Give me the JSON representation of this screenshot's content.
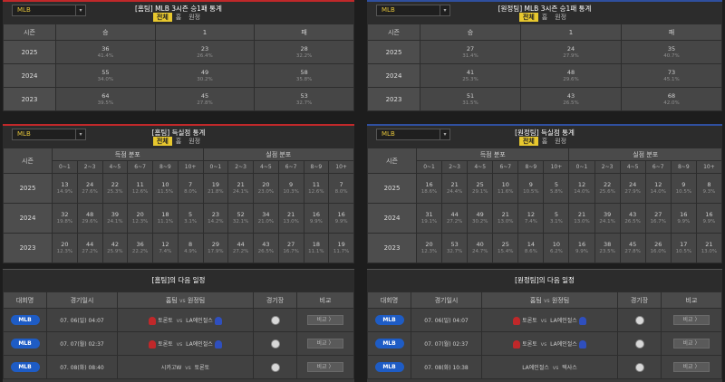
{
  "league_select": "MLB",
  "arrow_glyph": "▾",
  "tabs": {
    "all": "전체",
    "home": "홈",
    "away": "원정"
  },
  "record": {
    "home_title": "[홈팀] MLB 3시즌 승1패 통계",
    "away_title": "[원정팀] MLB 3시즌 승1패 통계",
    "headers": [
      "시즌",
      "승",
      "1",
      "패"
    ],
    "home_rows": [
      {
        "season": "2025",
        "cells": [
          [
            "36",
            "41.4%"
          ],
          [
            "23",
            "26.4%"
          ],
          [
            "28",
            "32.2%"
          ]
        ]
      },
      {
        "season": "2024",
        "cells": [
          [
            "55",
            "34.0%"
          ],
          [
            "49",
            "30.2%"
          ],
          [
            "58",
            "35.8%"
          ]
        ]
      },
      {
        "season": "2023",
        "cells": [
          [
            "64",
            "39.5%"
          ],
          [
            "45",
            "27.8%"
          ],
          [
            "53",
            "32.7%"
          ]
        ]
      }
    ],
    "away_rows": [
      {
        "season": "2025",
        "cells": [
          [
            "27",
            "31.4%"
          ],
          [
            "24",
            "27.9%"
          ],
          [
            "35",
            "40.7%"
          ]
        ]
      },
      {
        "season": "2024",
        "cells": [
          [
            "41",
            "25.3%"
          ],
          [
            "48",
            "29.6%"
          ],
          [
            "73",
            "45.1%"
          ]
        ]
      },
      {
        "season": "2023",
        "cells": [
          [
            "51",
            "31.5%"
          ],
          [
            "43",
            "26.5%"
          ],
          [
            "68",
            "42.0%"
          ]
        ]
      }
    ]
  },
  "runs": {
    "home_title": "[홈팀] 득실점 통계",
    "away_title": "[원정팀] 득실점 통계",
    "season_label": "시즌",
    "scored_label": "득점 분포",
    "allowed_label": "실점 분포",
    "bins": [
      "0~1",
      "2~3",
      "4~5",
      "6~7",
      "8~9",
      "10+"
    ],
    "home_rows": [
      {
        "season": "2025",
        "scored": [
          [
            "13",
            "14.9%"
          ],
          [
            "24",
            "27.6%"
          ],
          [
            "22",
            "25.3%"
          ],
          [
            "11",
            "12.6%"
          ],
          [
            "10",
            "11.5%"
          ],
          [
            "7",
            "8.0%"
          ]
        ],
        "allowed": [
          [
            "19",
            "21.8%"
          ],
          [
            "21",
            "24.1%"
          ],
          [
            "20",
            "23.0%"
          ],
          [
            "9",
            "10.3%"
          ],
          [
            "11",
            "12.6%"
          ],
          [
            "7",
            "8.0%"
          ]
        ]
      },
      {
        "season": "2024",
        "scored": [
          [
            "32",
            "19.8%"
          ],
          [
            "48",
            "29.6%"
          ],
          [
            "39",
            "24.1%"
          ],
          [
            "20",
            "12.3%"
          ],
          [
            "18",
            "11.1%"
          ],
          [
            "5",
            "3.1%"
          ]
        ],
        "allowed": [
          [
            "23",
            "14.2%"
          ],
          [
            "52",
            "32.1%"
          ],
          [
            "34",
            "21.0%"
          ],
          [
            "21",
            "13.0%"
          ],
          [
            "16",
            "9.9%"
          ],
          [
            "16",
            "9.9%"
          ]
        ]
      },
      {
        "season": "2023",
        "scored": [
          [
            "20",
            "12.3%"
          ],
          [
            "44",
            "27.2%"
          ],
          [
            "42",
            "25.9%"
          ],
          [
            "36",
            "22.2%"
          ],
          [
            "12",
            "7.4%"
          ],
          [
            "8",
            "4.9%"
          ]
        ],
        "allowed": [
          [
            "29",
            "17.9%"
          ],
          [
            "44",
            "27.2%"
          ],
          [
            "43",
            "26.5%"
          ],
          [
            "27",
            "16.7%"
          ],
          [
            "18",
            "11.1%"
          ],
          [
            "19",
            "11.7%"
          ]
        ]
      }
    ],
    "away_rows": [
      {
        "season": "2025",
        "scored": [
          [
            "16",
            "18.6%"
          ],
          [
            "21",
            "24.4%"
          ],
          [
            "25",
            "29.1%"
          ],
          [
            "10",
            "11.6%"
          ],
          [
            "9",
            "10.5%"
          ],
          [
            "5",
            "5.8%"
          ]
        ],
        "allowed": [
          [
            "12",
            "14.0%"
          ],
          [
            "22",
            "25.6%"
          ],
          [
            "24",
            "27.9%"
          ],
          [
            "12",
            "14.0%"
          ],
          [
            "9",
            "10.5%"
          ],
          [
            "8",
            "9.3%"
          ]
        ]
      },
      {
        "season": "2024",
        "scored": [
          [
            "31",
            "19.1%"
          ],
          [
            "44",
            "27.2%"
          ],
          [
            "49",
            "30.2%"
          ],
          [
            "21",
            "13.0%"
          ],
          [
            "12",
            "7.4%"
          ],
          [
            "5",
            "3.1%"
          ]
        ],
        "allowed": [
          [
            "21",
            "13.0%"
          ],
          [
            "39",
            "24.1%"
          ],
          [
            "43",
            "26.5%"
          ],
          [
            "27",
            "16.7%"
          ],
          [
            "16",
            "9.9%"
          ],
          [
            "16",
            "9.9%"
          ]
        ]
      },
      {
        "season": "2023",
        "scored": [
          [
            "20",
            "12.3%"
          ],
          [
            "53",
            "32.7%"
          ],
          [
            "40",
            "24.7%"
          ],
          [
            "25",
            "15.4%"
          ],
          [
            "14",
            "8.6%"
          ],
          [
            "10",
            "6.2%"
          ]
        ],
        "allowed": [
          [
            "16",
            "9.9%"
          ],
          [
            "38",
            "23.5%"
          ],
          [
            "45",
            "27.8%"
          ],
          [
            "26",
            "16.0%"
          ],
          [
            "17",
            "10.5%"
          ],
          [
            "21",
            "13.0%"
          ]
        ]
      }
    ]
  },
  "schedule": {
    "home_title": "[홈팀]의 다음 일정",
    "away_title": "[원정팀]의 다음 일정",
    "headers": {
      "league": "대회명",
      "date": "경기일시",
      "home": "홈팀",
      "vs": "vs",
      "away": "원정팀",
      "venue": "경기장",
      "compare": "비교"
    },
    "compare_btn": "비교 〉",
    "home_rows": [
      {
        "league": "MLB",
        "date": "07. 06(일) 04:07",
        "home": "토론토",
        "away": "LA에인절스",
        "home_color": "#c0282a",
        "away_color": "#2f4fbe"
      },
      {
        "league": "MLB",
        "date": "07. 07(월) 02:37",
        "home": "토론토",
        "away": "LA에인절스",
        "home_color": "#c0282a",
        "away_color": "#2f4fbe"
      },
      {
        "league": "MLB",
        "date": "07. 08(화) 08:40",
        "home": "시카고W",
        "away": "토론토",
        "home_color": "",
        "away_color": ""
      }
    ],
    "away_rows": [
      {
        "league": "MLB",
        "date": "07. 06(일) 04:07",
        "home": "토론토",
        "away": "LA에인절스",
        "home_color": "#c0282a",
        "away_color": "#2f4fbe"
      },
      {
        "league": "MLB",
        "date": "07. 07(월) 02:37",
        "home": "토론토",
        "away": "LA에인절스",
        "home_color": "#c0282a",
        "away_color": "#2f4fbe"
      },
      {
        "league": "MLB",
        "date": "07. 08(화) 10:38",
        "home": "LA에인절스",
        "away": "텍사스",
        "home_color": "",
        "away_color": ""
      }
    ]
  }
}
